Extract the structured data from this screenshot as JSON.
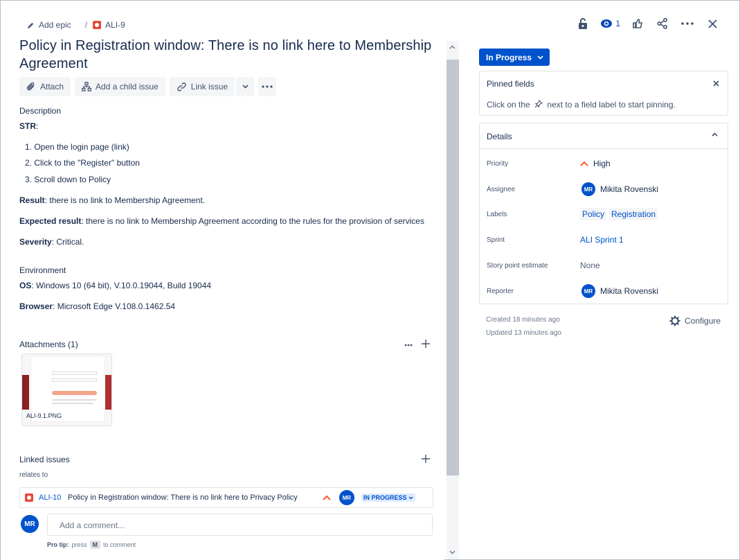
{
  "breadcrumb": {
    "add_epic": "Add epic",
    "issue_key": "ALI-9"
  },
  "top_actions": {
    "watch_count": "1"
  },
  "issue": {
    "title": "Policy in Registration window: There is no link here to Membership Agreement",
    "toolbar": {
      "attach": "Attach",
      "add_child": "Add a child issue",
      "link_issue": "Link issue"
    }
  },
  "description": {
    "label": "Description",
    "str_label": "STR",
    "str_suffix": ":",
    "steps": [
      "1. Open the login page (link)",
      "2. Click to the \"Register\" button",
      "3. Scroll down to Policy"
    ],
    "result_label": "Result",
    "result_text": ": there is no link to Membership Agreement.",
    "expected_label": "Expected result",
    "expected_text": ": there is no link to Membership Agreement according to the rules for the provision of services",
    "severity_label": "Severity",
    "severity_text": ": Critical."
  },
  "environment": {
    "label": "Environment",
    "os_label": "OS",
    "os_text": ": Windows 10 (64 bit), V.10.0.19044, Build 19044",
    "browser_label": "Browser",
    "browser_text": ": Microsoft Edge V.108.0.1462.54"
  },
  "attachments": {
    "label": "Attachments (1)",
    "file_name": "ALI-9.1.PNG"
  },
  "linked_issues": {
    "label": "Linked issues",
    "relation": "relates to",
    "item": {
      "key": "ALI-10",
      "summary": "Policy in Registration window: There is no link here to Privacy Policy",
      "assignee_initials": "MR",
      "status": "IN PROGRESS"
    }
  },
  "comment": {
    "avatar_initials": "MR",
    "placeholder": "Add a comment...",
    "protip_label": "Pro tip:",
    "protip_press": "press",
    "protip_key": "M",
    "protip_suffix": "to comment"
  },
  "sidebar": {
    "status": "In Progress",
    "pinned": {
      "title": "Pinned fields",
      "hint_before": "Click on the",
      "hint_after": "next to a field label to start pinning."
    },
    "details": {
      "title": "Details",
      "rows": [
        {
          "label": "Priority",
          "value": "High"
        },
        {
          "label": "Assignee",
          "value": "Mikita Rovenski",
          "initials": "MR"
        },
        {
          "label": "Labels",
          "values": [
            "Policy",
            "Registration"
          ]
        },
        {
          "label": "Sprint",
          "value": "ALI Sprint 1"
        },
        {
          "label": "Story point estimate",
          "value": "None"
        },
        {
          "label": "Reporter",
          "value": "Mikita Rovenski",
          "initials": "MR"
        }
      ]
    },
    "created": "Created 18 minutes ago",
    "updated": "Updated 13 minutes ago",
    "configure": "Configure"
  },
  "colors": {
    "accent": "#0052cc",
    "bug": "#e5493a",
    "priority_high": "#ff5630"
  }
}
